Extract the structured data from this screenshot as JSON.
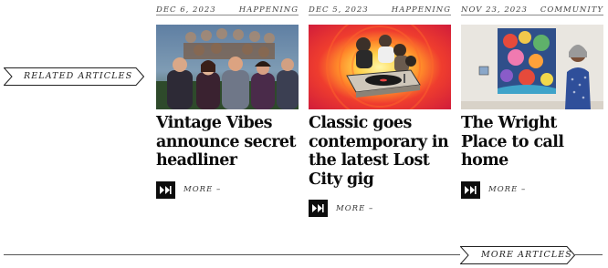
{
  "related_label": "RELATED ARTICLES",
  "more_articles_label": "MORE ARTICLES",
  "articles": [
    {
      "date": "DEC 6, 2023",
      "category": "HAPPENING",
      "title": "Vintage Vibes announce secret headliner",
      "more_label": "MORE –"
    },
    {
      "date": "DEC 5, 2023",
      "category": "HAPPENING",
      "title": "Classic goes contemporary in the latest Lost City gig",
      "more_label": "MORE –"
    },
    {
      "date": "NOV 23, 2023",
      "category": "COMMUNITY",
      "title": "The Wright Place to call home",
      "more_label": "MORE –"
    }
  ],
  "colors": {
    "text": "#0c0c0c",
    "button": "#0d0d0d",
    "rule": "#8a8a8a"
  },
  "icons": {
    "more_button": "double-chevron-right-icon"
  }
}
